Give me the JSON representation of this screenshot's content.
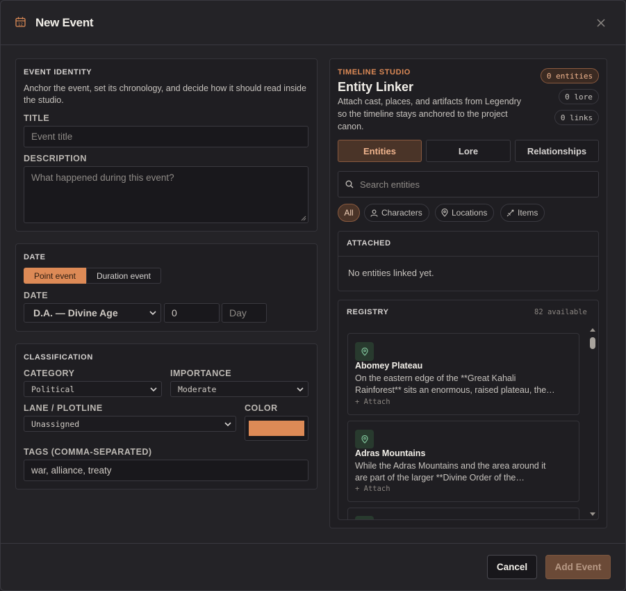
{
  "header": {
    "title": "New Event"
  },
  "identity": {
    "section_title": "EVENT IDENTITY",
    "help": "Anchor the event, set its chronology, and decide how it should read inside the studio.",
    "title_label": "TITLE",
    "title_placeholder": "Event title",
    "description_label": "DESCRIPTION",
    "description_placeholder": "What happened during this event?"
  },
  "date": {
    "section_title": "DATE",
    "toggle_point": "Point event",
    "toggle_duration": "Duration event",
    "date_label": "DATE",
    "era_value": "D.A. — Divine Age",
    "year_value": "0",
    "day_placeholder": "Day"
  },
  "classification": {
    "section_title": "CLASSIFICATION",
    "category_label": "CATEGORY",
    "category_value": "Political",
    "importance_label": "IMPORTANCE",
    "importance_value": "Moderate",
    "lane_label": "LANE / PLOTLINE",
    "lane_value": "Unassigned",
    "color_label": "COLOR",
    "color_value": "#dd8a56",
    "tags_label": "TAGS (COMMA-SEPARATED)",
    "tags_value": "war, alliance, treaty"
  },
  "linker": {
    "eyebrow": "TIMELINE STUDIO",
    "title": "Entity Linker",
    "description": "Attach cast, places, and artifacts from Legendry so the timeline stays anchored to the project canon.",
    "badges": [
      "0 entities",
      "0 lore",
      "0 links"
    ],
    "tabs": [
      "Entities",
      "Lore",
      "Relationships"
    ],
    "search_placeholder": "Search entities",
    "filters": [
      "All",
      "Characters",
      "Locations",
      "Items"
    ],
    "attached_title": "ATTACHED",
    "attached_empty": "No entities linked yet.",
    "registry_title": "REGISTRY",
    "registry_count": "82 available",
    "registry": [
      {
        "name": "Abomey Plateau",
        "desc1": "On the eastern edge of the **Great Kahali",
        "desc2": "Rainforest** sits an enormous, raised plateau, the…",
        "attach": "+ Attach"
      },
      {
        "name": "Adras Mountains",
        "desc1": "While the Adras Mountains and the area around it",
        "desc2": "are part of the larger **Divine Order of the…",
        "attach": "+ Attach"
      }
    ]
  },
  "footer": {
    "cancel": "Cancel",
    "submit": "Add Event"
  }
}
